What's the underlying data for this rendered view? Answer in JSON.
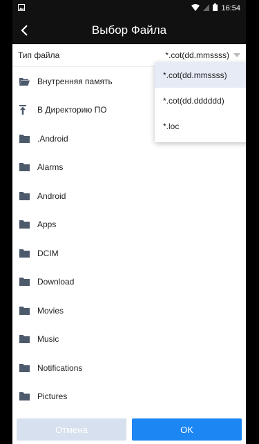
{
  "status_bar": {
    "time": "16:54"
  },
  "header": {
    "title": "Выбор Файла"
  },
  "filetype": {
    "label": "Тип файла",
    "value": "*.cot(dd.mmssss)"
  },
  "items": [
    {
      "label": "Внутренняя память",
      "icon": "folder-open-icon"
    },
    {
      "label": "В Директорию ПО",
      "icon": "upload-arrow-icon"
    },
    {
      "label": ".Android",
      "icon": "folder-icon"
    },
    {
      "label": "Alarms",
      "icon": "folder-icon"
    },
    {
      "label": "Android",
      "icon": "folder-icon"
    },
    {
      "label": "Apps",
      "icon": "folder-icon"
    },
    {
      "label": "DCIM",
      "icon": "folder-icon"
    },
    {
      "label": "Download",
      "icon": "folder-icon"
    },
    {
      "label": "Movies",
      "icon": "folder-icon"
    },
    {
      "label": "Music",
      "icon": "folder-icon"
    },
    {
      "label": "Notifications",
      "icon": "folder-icon"
    },
    {
      "label": "Pictures",
      "icon": "folder-icon"
    }
  ],
  "dropdown": {
    "options": [
      "*.cot(dd.mmssss)",
      "*.cot(dd.dddddd)",
      "*.loc"
    ],
    "selected_index": 0
  },
  "footer": {
    "cancel": "Отмена",
    "ok": "OK"
  },
  "colors": {
    "accent": "#1c86f2",
    "cancel_bg": "#d7e0ee",
    "bar_bg": "#111111"
  }
}
